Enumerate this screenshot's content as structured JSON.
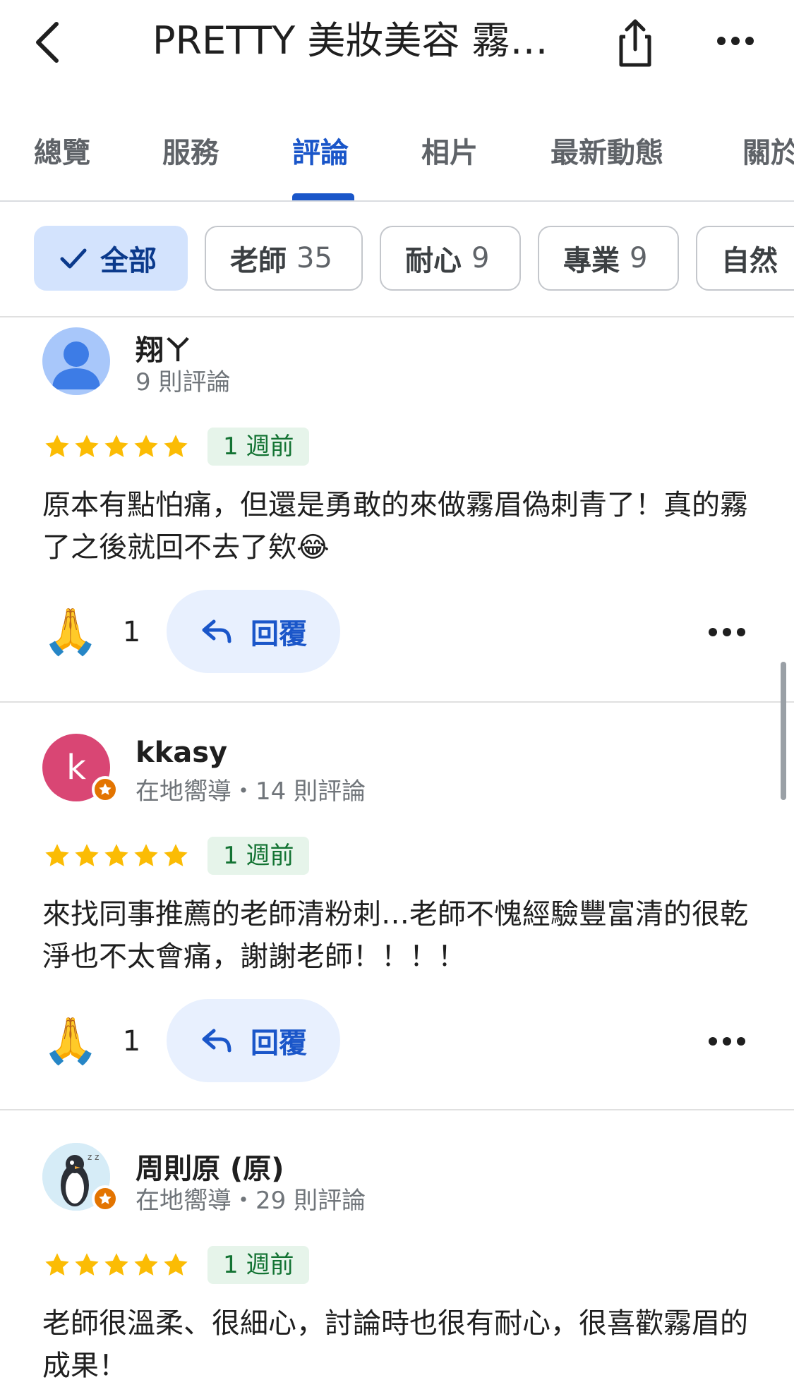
{
  "header": {
    "title": "PRETTY 美妝美容 霧…",
    "back_icon": "chevron-left-icon",
    "share_icon": "share-icon",
    "more_icon": "more-horizontal-icon"
  },
  "tabs": [
    {
      "label": "總覽",
      "active": false
    },
    {
      "label": "服務",
      "active": false
    },
    {
      "label": "評論",
      "active": true
    },
    {
      "label": "相片",
      "active": false
    },
    {
      "label": "最新動態",
      "active": false
    },
    {
      "label": "關於",
      "active": false
    }
  ],
  "chips": [
    {
      "label": "全部",
      "count": "",
      "selected": true
    },
    {
      "label": "老師",
      "count": "35",
      "selected": false
    },
    {
      "label": "耐心",
      "count": "9",
      "selected": false
    },
    {
      "label": "專業",
      "count": "9",
      "selected": false
    },
    {
      "label": "自然",
      "count": "",
      "selected": false
    }
  ],
  "reviews": [
    {
      "name": "翔ㄚ",
      "meta": "9 則評論",
      "avatar_initial": "",
      "rating": 5,
      "date": "1 週前",
      "text": "原本有點怕痛，但還是勇敢的來做霧眉偽刺青了！真的霧了之後就回不去了欸😂",
      "reaction_emoji": "🙏",
      "reaction_count": "1",
      "reply_label": "回覆"
    },
    {
      "name": "kkasy",
      "meta": "在地嚮導・14 則評論",
      "avatar_initial": "k",
      "rating": 5,
      "date": "1 週前",
      "text": "來找同事推薦的老師清粉刺…老師不愧經驗豐富清的很乾淨也不太會痛，謝謝老師！！！！",
      "reaction_emoji": "🙏",
      "reaction_count": "1",
      "reply_label": "回覆"
    },
    {
      "name": "周則原 (原)",
      "meta": "在地嚮導・29 則評論",
      "avatar_initial": "",
      "rating": 5,
      "date": "1 週前",
      "text": "老師很溫柔、很細心，討論時也很有耐心，很喜歡霧眉的成果！"
    }
  ],
  "colors": {
    "accent": "#1a56c9",
    "star": "#fbbc04",
    "date_badge_bg": "#e6f4ea",
    "date_badge_text": "#137333",
    "avatar_k": "#d94674",
    "local_guide_badge": "#e37400"
  }
}
